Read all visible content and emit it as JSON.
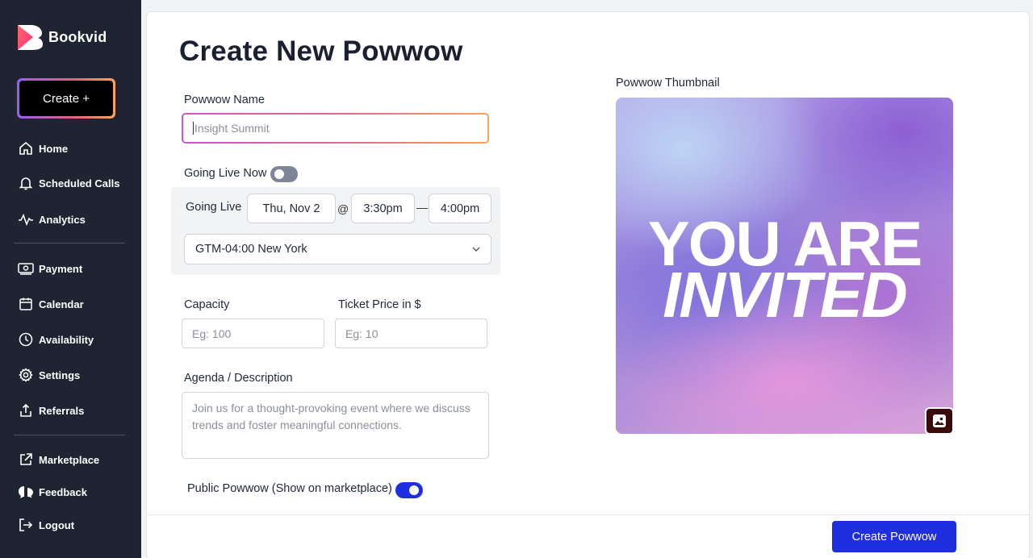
{
  "app": {
    "name": "Bookvid"
  },
  "sidebar": {
    "create_label": "Create +",
    "items": [
      {
        "label": "Home",
        "icon": "home-icon"
      },
      {
        "label": "Scheduled Calls",
        "icon": "bell-icon"
      },
      {
        "label": "Analytics",
        "icon": "activity-icon"
      },
      {
        "label": "Payment",
        "icon": "money-icon"
      },
      {
        "label": "Calendar",
        "icon": "calendar-icon"
      },
      {
        "label": "Availability",
        "icon": "clock-icon"
      },
      {
        "label": "Settings",
        "icon": "gear-icon"
      },
      {
        "label": "Referrals",
        "icon": "share-icon"
      },
      {
        "label": "Marketplace",
        "icon": "external-link-icon"
      },
      {
        "label": "Feedback",
        "icon": "chat-icon"
      },
      {
        "label": "Logout",
        "icon": "logout-icon"
      }
    ]
  },
  "form": {
    "title": "Create New Powwow",
    "name_label": "Powwow Name",
    "name_placeholder": "Insight Summit",
    "going_live_now_label": "Going Live Now",
    "going_live_now_on": false,
    "going_live_label": "Going Live",
    "date": "Thu, Nov 2",
    "at_symbol": "@",
    "start_time": "3:30pm",
    "dash": "—",
    "end_time": "4:00pm",
    "timezone": "GTM-04:00 New York",
    "capacity_label": "Capacity",
    "capacity_placeholder": "Eg: 100",
    "price_label": "Ticket Price in $",
    "price_placeholder": "Eg: 10",
    "agenda_label": "Agenda / Description",
    "agenda_placeholder": "Join us for a thought-provoking event where we discuss trends and foster meaningful connections.",
    "public_label": "Public Powwow (Show on marketplace)",
    "public_on": true,
    "thumbnail_label": "Powwow Thumbnail",
    "thumbnail_line1": "YOU ARE",
    "thumbnail_line2": "INVITED",
    "submit_label": "Create Powwow"
  },
  "colors": {
    "sidebar_bg": "#1e2431",
    "accent": "#1f2fe0",
    "brand_gradient": [
      "#9b5cf6",
      "#e0607e",
      "#f6a55a"
    ]
  }
}
